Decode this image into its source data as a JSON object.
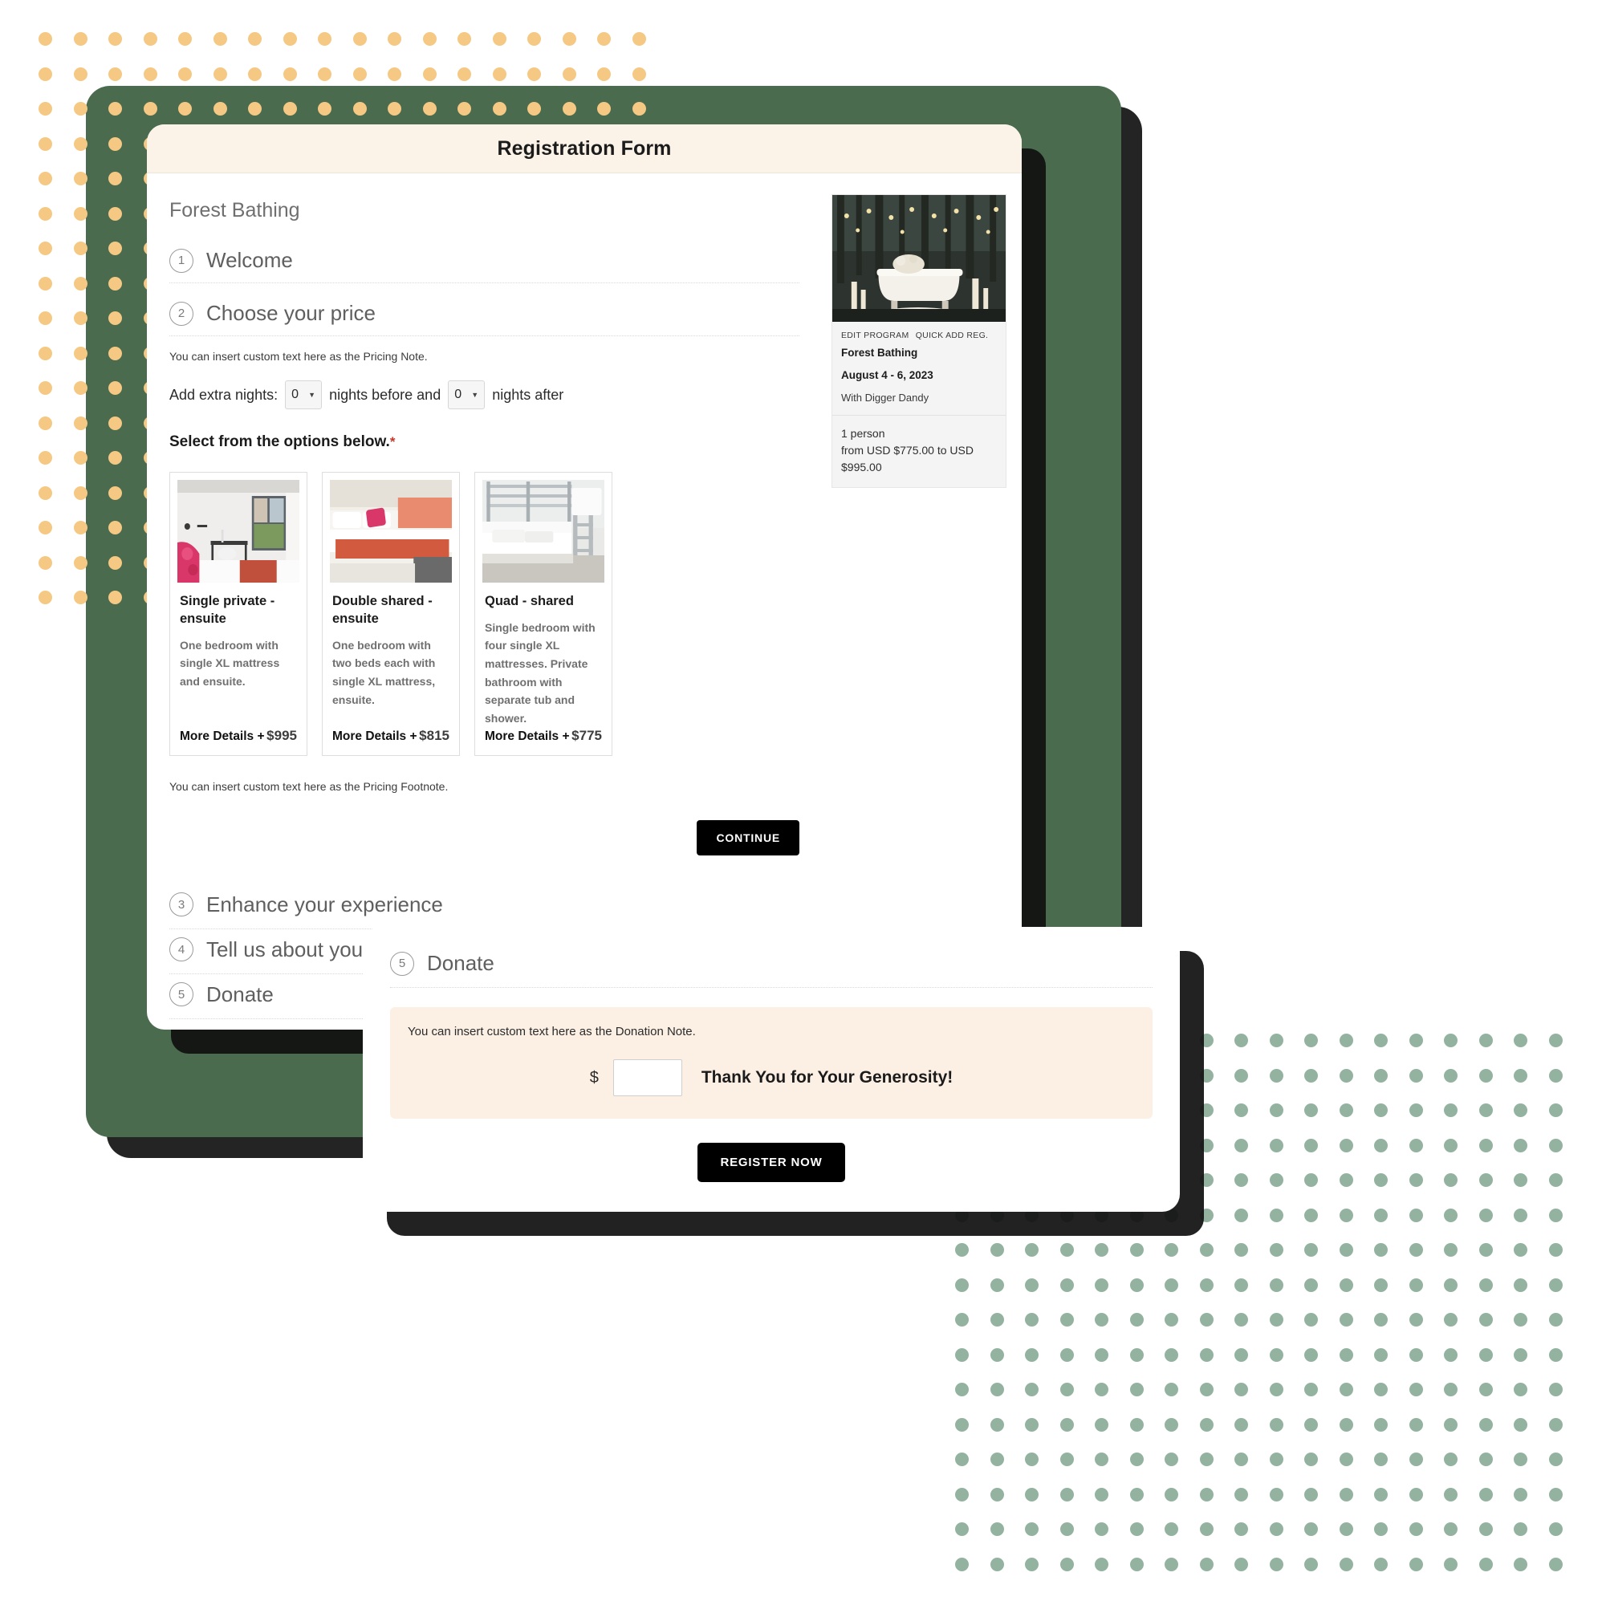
{
  "window": {
    "title": "Registration Form",
    "program_name": "Forest Bathing"
  },
  "steps": [
    {
      "num": "1",
      "label": "Welcome"
    },
    {
      "num": "2",
      "label": "Choose your price"
    },
    {
      "num": "3",
      "label": "Enhance your experience"
    },
    {
      "num": "4",
      "label": "Tell us about yourself"
    },
    {
      "num": "5",
      "label": "Donate"
    }
  ],
  "pricing": {
    "note": "You can insert custom text here as the Pricing Note.",
    "footnote": "You can insert custom text here as the Pricing Footnote.",
    "extra_nights_label": "Add extra nights:",
    "nights_before_value": "0",
    "nights_before_label": "nights before and",
    "nights_after_value": "0",
    "nights_after_label": "nights after",
    "options_heading": "Select from the options below.",
    "required_mark": "*",
    "continue_label": "CONTINUE"
  },
  "options": [
    {
      "title": "Single private - ensuite",
      "description": "One bedroom with single XL mattress and ensuite.",
      "more_details": "More Details +",
      "price": "$995",
      "image": "single-private-room-photo"
    },
    {
      "title": "Double shared - ensuite",
      "description": "One bedroom with two beds each with single XL mattress, ensuite.",
      "more_details": "More Details +",
      "price": "$815",
      "image": "double-shared-room-photo"
    },
    {
      "title": "Quad - shared",
      "description": "Single bedroom with four single XL mattresses. Private bathroom with separate tub and shower.",
      "more_details": "More Details +",
      "price": "$775",
      "image": "quad-shared-bunkbed-photo"
    }
  ],
  "summary": {
    "image": "forest-bathtub-photo",
    "action_edit": "EDIT PROGRAM",
    "action_quick_add": "QUICK ADD REG.",
    "program_title": "Forest Bathing",
    "dates": "August 4 - 6, 2023",
    "host": "With Digger Dandy",
    "persons": "1 person",
    "price_range": "from USD $775.00 to USD $995.00"
  },
  "donate": {
    "step_num": "5",
    "step_label": "Donate",
    "note": "You can insert custom text here as the Donation Note.",
    "currency_symbol": "$",
    "amount_value": "",
    "amount_placeholder": "",
    "thanks_text": "Thank You for Your Generosity!",
    "register_label": "REGISTER NOW"
  },
  "decor": {
    "dot_color_top": "#f5c883",
    "dot_color_bottom": "#93b3a0",
    "green_panel": "#4a6b4e",
    "titlebar_bg": "#fcf3e8",
    "accent_required": "#c0392b"
  }
}
